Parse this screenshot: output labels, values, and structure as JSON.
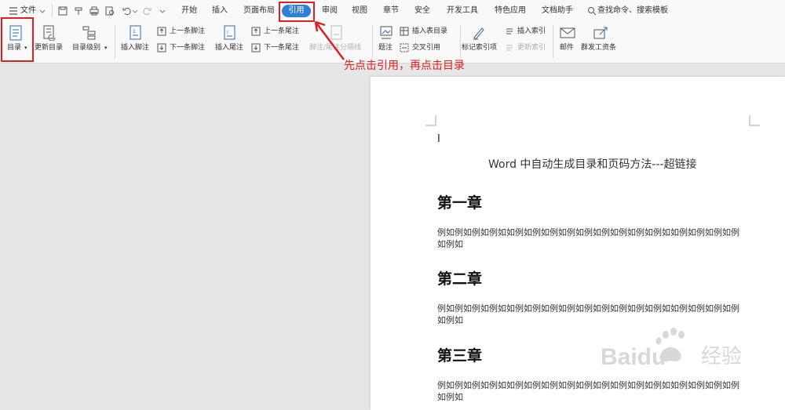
{
  "menubar": {
    "file_label": "文件",
    "tabs": [
      {
        "id": "start",
        "label": "开始"
      },
      {
        "id": "insert",
        "label": "插入"
      },
      {
        "id": "layout",
        "label": "页面布局"
      },
      {
        "id": "references",
        "label": "引用",
        "active": true
      },
      {
        "id": "review",
        "label": "审阅"
      },
      {
        "id": "view",
        "label": "视图"
      },
      {
        "id": "chapter",
        "label": "章节"
      },
      {
        "id": "security",
        "label": "安全"
      },
      {
        "id": "devtools",
        "label": "开发工具"
      },
      {
        "id": "features",
        "label": "特色应用"
      },
      {
        "id": "docassist",
        "label": "文档助手"
      }
    ],
    "search_label": "查找命令、搜索模板"
  },
  "ribbon": {
    "toc": "目录",
    "update_toc": "更新目录",
    "toc_level": "目录级别",
    "insert_footnote": "插入脚注",
    "prev_footnote": "上一条脚注",
    "next_footnote": "下一条脚注",
    "insert_endnote": "插入尾注",
    "prev_endnote": "上一条尾注",
    "next_endnote": "下一条尾注",
    "separator_line": "脚注/尾注分隔线",
    "caption": "题注",
    "insert_table_toc": "插入表目录",
    "cross_ref": "交叉引用",
    "mark_index": "标记索引项",
    "insert_index": "插入索引",
    "update_index": "更新索引",
    "mail": "邮件",
    "mass_send": "群发工资条"
  },
  "annotation": "先点击引用，再点击目录",
  "document": {
    "cursor": "I",
    "title": "Word 中自动生成目录和页码方法---超链接",
    "sections": [
      {
        "heading": "第一章",
        "body": "例如例如例如例如如例如例如例如例如例如例如例如例如例如如例如例如例如例如例如"
      },
      {
        "heading": "第二章",
        "body": "例如例如例如例如如例如例如例如例如例如例如例如例如例如如例如例如例如例如例如"
      },
      {
        "heading": "第三章",
        "body": "例如例如例如例如如例如例如例如例如例如例如例如例如例如如例如例如例如例如例如"
      }
    ]
  },
  "watermark": {
    "brand": "Baidu",
    "suffix": "经验"
  },
  "colors": {
    "accent": "#2f7ed8",
    "annotation": "#e02020"
  }
}
